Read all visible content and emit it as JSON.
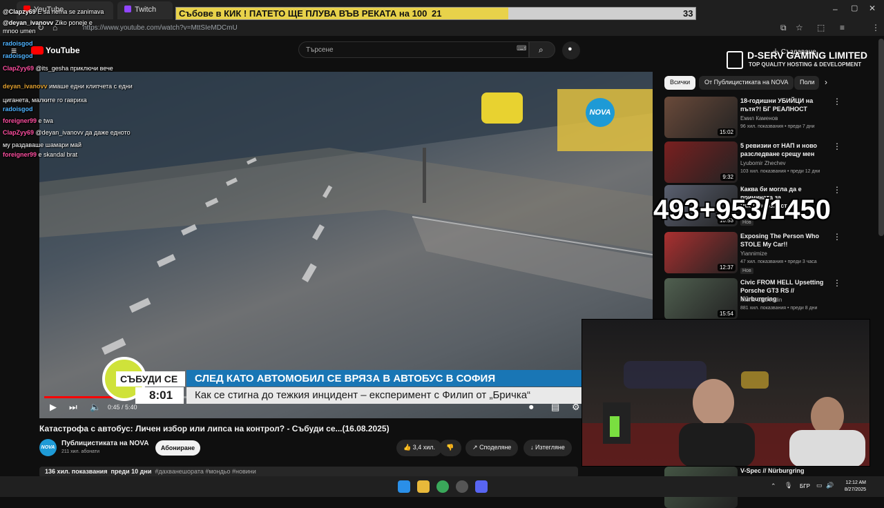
{
  "browser": {
    "tabs": [
      {
        "label": "YouTube",
        "icon": "youtube-icon",
        "color": "#ff0000"
      },
      {
        "label": "Twitch",
        "icon": "twitch-icon",
        "color": "#9146ff"
      }
    ],
    "url": "https://www.youtube.com/watch?v=MttSIeMDCmU"
  },
  "score_overlay": {
    "text": "Събове в КИК ! ПАТЕТО ЩЕ ПЛУВА ВЪВ РЕКАТА на 100",
    "current": "21",
    "goal": "33",
    "progress_fraction": 0.64
  },
  "youtube": {
    "logo": "YouTube",
    "search_placeholder": "Търсене",
    "create_label": "Създаване"
  },
  "sponsor": {
    "name": "D-SERV GAMING LIMITED",
    "tagline": "TOP QUALITY HOSTING & DEVELOPMENT"
  },
  "chat": [
    {
      "user": "@Clapzy69",
      "text": "E sa nema se zanimava",
      "color": "#ffffff"
    },
    {
      "user": "@deyan_ivanovv",
      "text": "Ziko poneje e",
      "color": "#ffffff"
    },
    {
      "user": "",
      "text": "mnoo umen",
      "color": "#ffffff"
    },
    {
      "user": "radoisgod",
      "text": "",
      "color": "#4fb3ff"
    },
    {
      "user": "radoisgod",
      "text": "",
      "color": "#4fb3ff"
    },
    {
      "user": "ClapZyy69",
      "text": "@its_gesha приключи вече",
      "color": "#ff4fa0"
    },
    {
      "user": "deyan_ivanovv",
      "text": "имаше едни клипчета с едни",
      "color": "#e0a030"
    },
    {
      "user": "",
      "text": "циганета, малките го гавриха",
      "color": "#ffffff"
    },
    {
      "user": "radoisgod",
      "text": "",
      "color": "#4fb3ff"
    },
    {
      "user": "foreigner99",
      "text": "e twa",
      "color": "#ff4fa0"
    },
    {
      "user": "ClapZyy69",
      "text": "@deyan_ivanovv да даже едното",
      "color": "#ff4fa0"
    },
    {
      "user": "",
      "text": "му раздаваше шамари май",
      "color": "#ffffff"
    },
    {
      "user": "foreigner99",
      "text": "e skandal brat",
      "color": "#ff4fa0"
    }
  ],
  "video": {
    "channel_logo": "NOVA",
    "lower_third_brand": "СЪБУДИ СЕ",
    "headline": "СЛЕД КАТО АВТОМОБИЛ СЕ ВРЯЗА В АВТОБУС В СОФИЯ",
    "clock": "8:01",
    "subtitle": "Как се стигна до тежкия инцидент – експеримент с Филип от „Бричка“",
    "time": "0:45 / 5:40",
    "progress_fraction": 0.15,
    "title": "Катастрофа с автобус: Личен избор или липса на контрол? - Събуди се...(16.08.2025)",
    "channel": "Публицистиката на NOVA",
    "subscribers": "211 хил. абонати",
    "subscribe": "Абониране",
    "likes": "3,4 хил.",
    "share": "Споделяне",
    "download": "Изтегляне",
    "views": "136 хил. показвания",
    "date": "преди 10 дни",
    "tags": "#дахванешората #мондьо #новини"
  },
  "filters": [
    "Всички",
    "От Публицистиката на NOVA",
    "Поли"
  ],
  "recommendations": [
    {
      "title": "18-годишни УБИЙЦИ на пътя?! БГ РЕАЛНОСТ",
      "channel": "Емил Каменов",
      "meta": "96 хил. показвания • преди 7 дни",
      "duration": "15:02",
      "badge": "",
      "thumb": "#6a4a3a"
    },
    {
      "title": "5 ревизии от НАП и ново разследване срещу мен",
      "channel": "Lyubomir Zhechev",
      "meta": "103 хил. показвания • преди 12 дни",
      "duration": "9:32",
      "badge": "",
      "thumb": "#7a2020"
    },
    {
      "title": "Каква би могла да е причината за мистериозност",
      "channel": "",
      "meta": "",
      "duration": "10:53",
      "badge": "Нов",
      "thumb": "#5a6070"
    },
    {
      "title": "Exposing The Person Who STOLE My Car!!",
      "channel": "Yiannimize",
      "meta": "47 хил. показвания • преди 3 часа",
      "duration": "12:37",
      "badge": "Нов",
      "thumb": "#aa3030"
    },
    {
      "title": "Civic FROM HELL Upsetting Porsche GT3 RS // Nürburgring",
      "channel": "Misha Charoudin",
      "meta": "881 хил. показвания • преди 8 дни",
      "duration": "15:54",
      "badge": "",
      "thumb": "#506050"
    },
    {
      "title": "V-Spec // Nürburgring",
      "channel": "",
      "meta": "",
      "duration": "",
      "badge": "",
      "thumb": "#445544"
    }
  ],
  "counter_overlay": "493+953/1450",
  "taskbar": {
    "lang": "БГР",
    "time": "12:12 AM",
    "date": "8/27/2025"
  }
}
